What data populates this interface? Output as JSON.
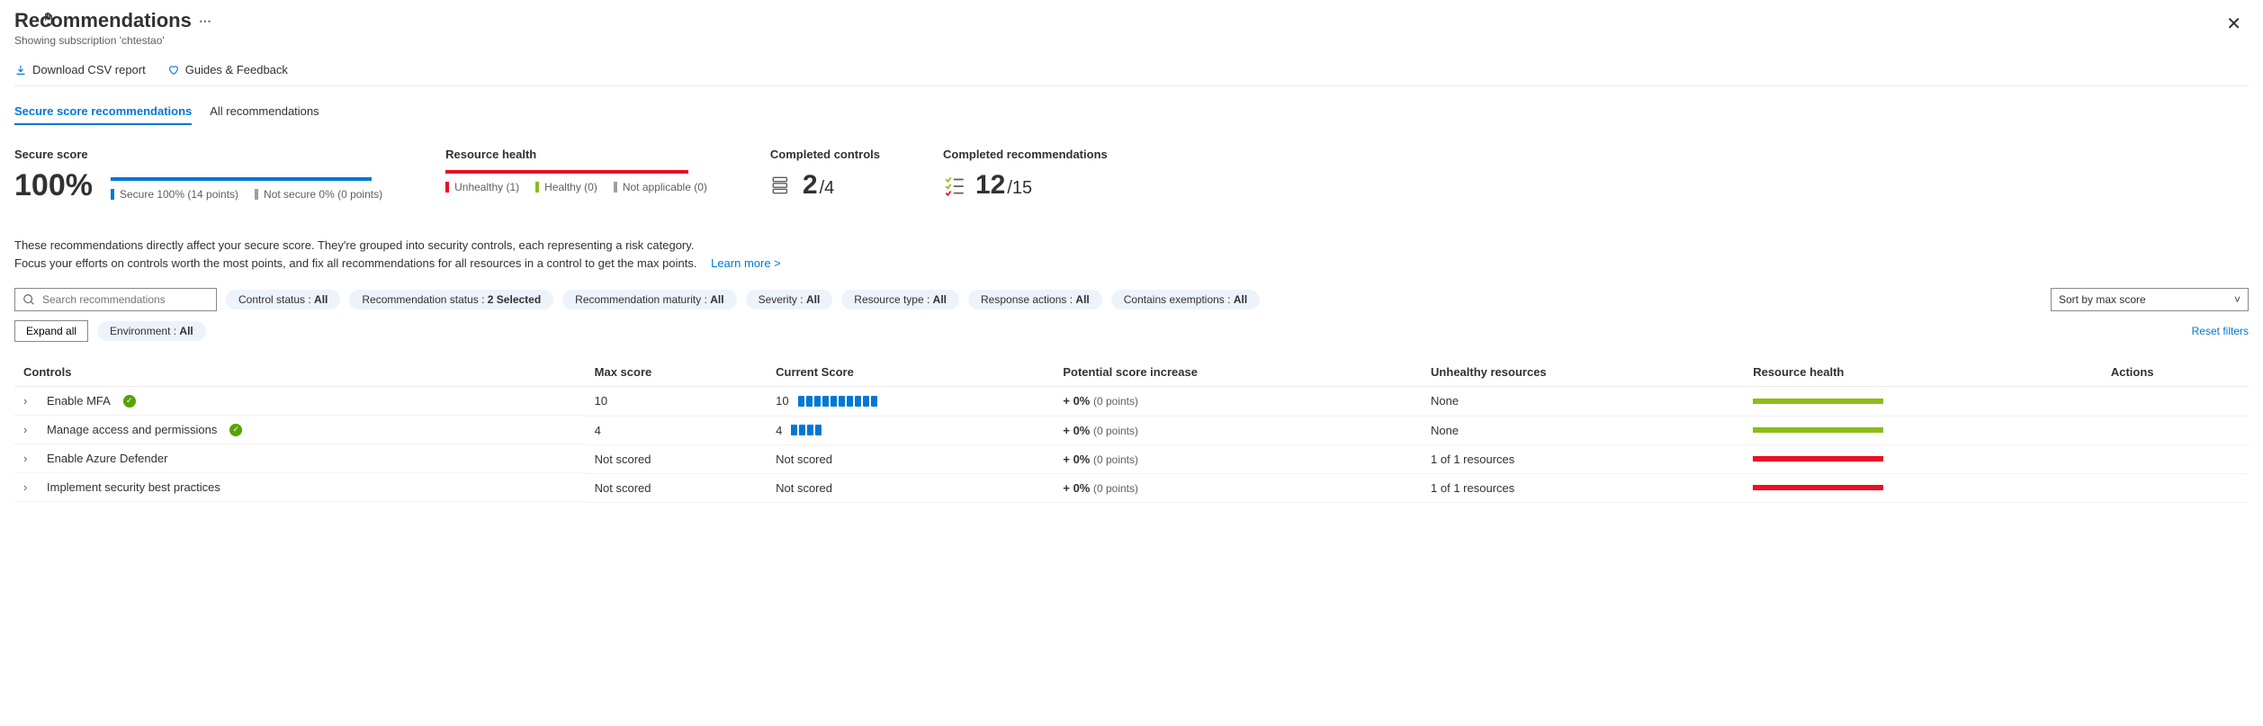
{
  "header": {
    "title": "Recommendations",
    "subtitle": "Showing subscription 'chtestao'"
  },
  "toolbar": {
    "download": "Download CSV report",
    "guides": "Guides & Feedback"
  },
  "tabs": {
    "secure": "Secure score recommendations",
    "all": "All recommendations"
  },
  "summary": {
    "secure_score_label": "Secure score",
    "secure_score_value": "100%",
    "secure_legend_1": "Secure 100% (14 points)",
    "secure_legend_2": "Not secure 0% (0 points)",
    "rh_label": "Resource health",
    "rh_unhealthy": "Unhealthy (1)",
    "rh_healthy": "Healthy (0)",
    "rh_na": "Not applicable (0)",
    "completed_controls_label": "Completed controls",
    "completed_controls_num": "2",
    "completed_controls_denom": "/4",
    "completed_rec_label": "Completed recommendations",
    "completed_rec_num": "12",
    "completed_rec_denom": "/15"
  },
  "description": {
    "line1": "These recommendations directly affect your secure score. They're grouped into security controls, each representing a risk category.",
    "line2": "Focus your efforts on controls worth the most points, and fix all recommendations for all resources in a control to get the max points.",
    "learn_more": "Learn more >"
  },
  "filters": {
    "search_placeholder": "Search recommendations",
    "control_status": "Control status : ",
    "control_status_v": "All",
    "rec_status": "Recommendation status : ",
    "rec_status_v": "2 Selected",
    "maturity": "Recommendation maturity : ",
    "maturity_v": "All",
    "severity": "Severity : ",
    "severity_v": "All",
    "res_type": "Resource type : ",
    "res_type_v": "All",
    "response": "Response actions : ",
    "response_v": "All",
    "exemptions": "Contains exemptions : ",
    "exemptions_v": "All",
    "environment": "Environment : ",
    "environment_v": "All",
    "sort": "Sort by max score",
    "expand": "Expand all",
    "reset": "Reset filters"
  },
  "table": {
    "headers": {
      "controls": "Controls",
      "max": "Max score",
      "current": "Current Score",
      "potential": "Potential score increase",
      "unhealthy": "Unhealthy resources",
      "rh": "Resource health",
      "actions": "Actions"
    },
    "rows": [
      {
        "name": "Enable MFA",
        "check": true,
        "max": "10",
        "cur": "10",
        "dots": 10,
        "pct": "+ 0%",
        "pts": "(0 points)",
        "unhealthy": "None",
        "rh": "green"
      },
      {
        "name": "Manage access and permissions",
        "check": true,
        "max": "4",
        "cur": "4",
        "dots": 4,
        "pct": "+ 0%",
        "pts": "(0 points)",
        "unhealthy": "None",
        "rh": "green"
      },
      {
        "name": "Enable Azure Defender",
        "check": false,
        "max": "Not scored",
        "cur": "Not scored",
        "dots": 0,
        "pct": "+ 0%",
        "pts": "(0 points)",
        "unhealthy": "1 of 1 resources",
        "rh": "red"
      },
      {
        "name": "Implement security best practices",
        "check": false,
        "max": "Not scored",
        "cur": "Not scored",
        "dots": 0,
        "pct": "+ 0%",
        "pts": "(0 points)",
        "unhealthy": "1 of 1 resources",
        "rh": "red"
      }
    ]
  }
}
